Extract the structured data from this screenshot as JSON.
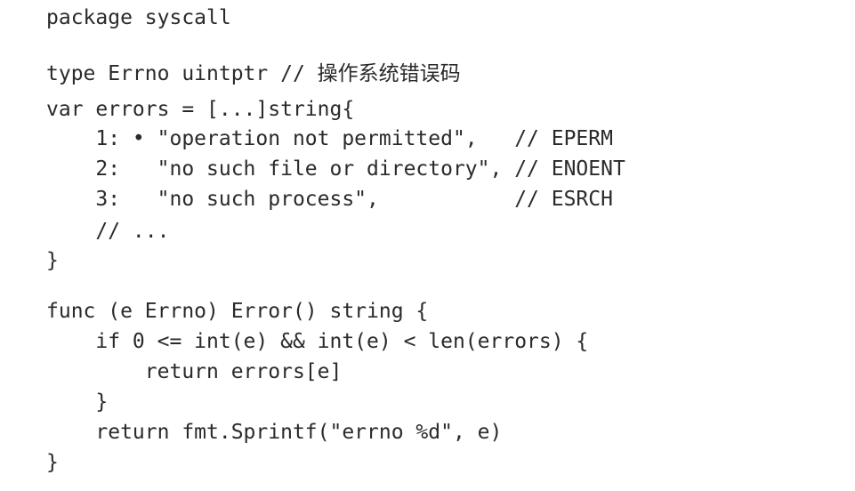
{
  "code": {
    "lines": [
      "package syscall",
      "",
      "type Errno uintptr // 操作系统错误码",
      "var errors = [...]string{",
      "    1: • \"operation not permitted\",   // EPERM",
      "    2:   \"no such file or directory\", // ENOENT",
      "    3:   \"no such process\",           // ESRCH",
      "    // ...",
      "}",
      "",
      "func (e Errno) Error() string {",
      "    if 0 <= int(e) && int(e) < len(errors) {",
      "        return errors[e]",
      "    }",
      "    return fmt.Sprintf(\"errno %d\", e)",
      "}"
    ]
  }
}
